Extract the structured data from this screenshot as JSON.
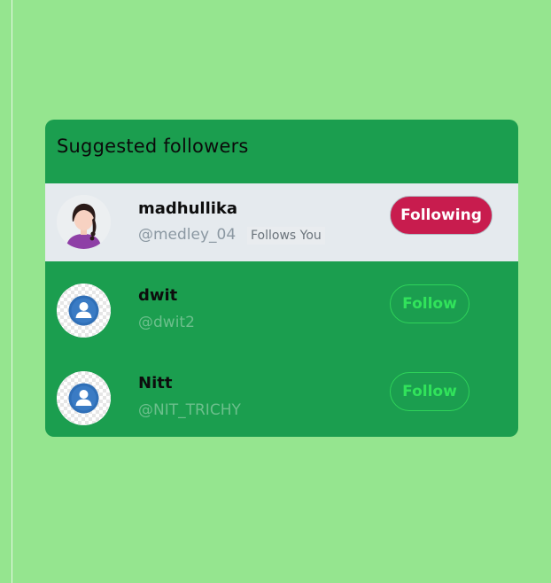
{
  "colors": {
    "page_bg": "#95e58f",
    "card_bg": "#1b9e4f",
    "highlight_bg": "#e5eaee",
    "following_btn": "#c81c4e",
    "follow_btn_text": "#31e35b"
  },
  "card": {
    "title": "Suggested followers",
    "users": [
      {
        "name": "madhullika",
        "handle": "@medley_04",
        "follows_you": "Follows You",
        "button_label": "Following",
        "avatar_icon": "female-user-avatar-icon"
      },
      {
        "name": "dwit",
        "handle": "@dwit2",
        "button_label": "Follow",
        "avatar_icon": "default-user-avatar-icon"
      },
      {
        "name": "Nitt",
        "handle": "@NIT_TRICHY",
        "button_label": "Follow",
        "avatar_icon": "default-user-avatar-icon"
      }
    ]
  }
}
